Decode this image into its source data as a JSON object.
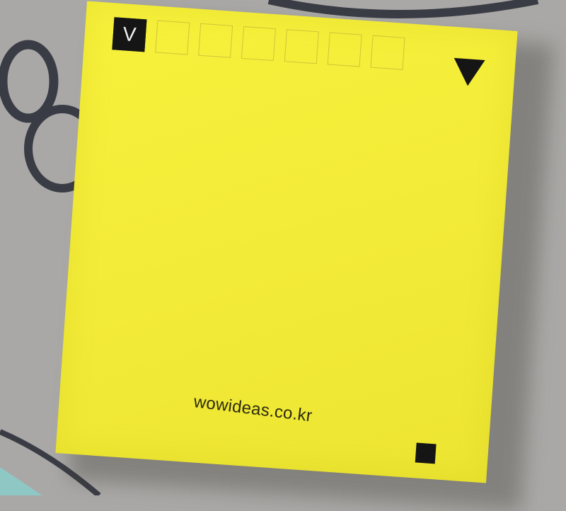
{
  "note": {
    "color": "#f5ef3a",
    "first_box_letter": "V",
    "boxes": [
      {
        "checked": true
      },
      {
        "checked": false
      },
      {
        "checked": false
      },
      {
        "checked": false
      },
      {
        "checked": false
      },
      {
        "checked": false
      },
      {
        "checked": false
      }
    ],
    "brand_text": "wowideas.co.kr"
  }
}
